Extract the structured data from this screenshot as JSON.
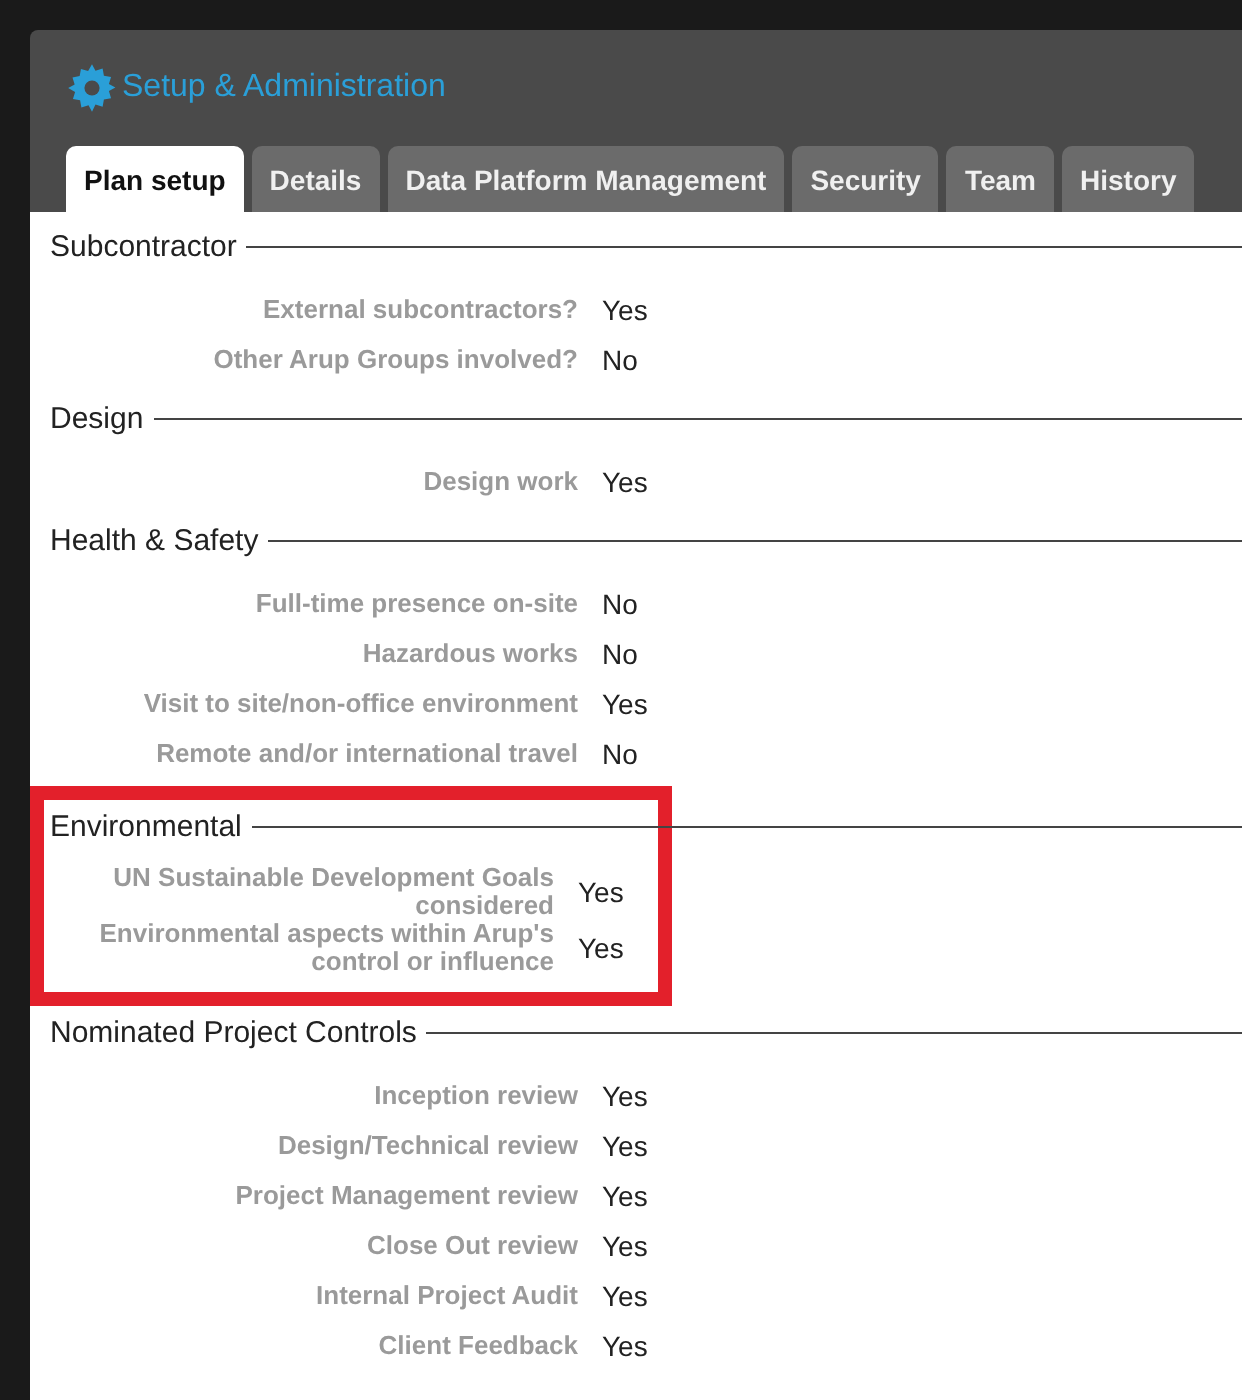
{
  "header": {
    "title": "Setup & Administration"
  },
  "tabs": [
    {
      "label": "Plan setup",
      "selected": true
    },
    {
      "label": "Details",
      "selected": false
    },
    {
      "label": "Data Platform Management",
      "selected": false
    },
    {
      "label": "Security",
      "selected": false
    },
    {
      "label": "Team",
      "selected": false
    },
    {
      "label": "History",
      "selected": false
    }
  ],
  "sections": [
    {
      "title": "Subcontractor",
      "highlighted": false,
      "rows": [
        {
          "label": "External subcontractors?",
          "value": "Yes"
        },
        {
          "label": "Other Arup Groups involved?",
          "value": "No"
        }
      ]
    },
    {
      "title": "Design",
      "highlighted": false,
      "rows": [
        {
          "label": "Design work",
          "value": "Yes"
        }
      ]
    },
    {
      "title": "Health & Safety",
      "highlighted": false,
      "rows": [
        {
          "label": "Full-time presence on-site",
          "value": "No"
        },
        {
          "label": "Hazardous works",
          "value": "No"
        },
        {
          "label": "Visit to site/non-office environment",
          "value": "Yes"
        },
        {
          "label": "Remote and/or international travel",
          "value": "No"
        }
      ]
    },
    {
      "title": "Environmental",
      "highlighted": true,
      "rows": [
        {
          "label": "UN Sustainable Development Goals considered",
          "value": "Yes"
        },
        {
          "label": "Environmental aspects within Arup's control or influence",
          "value": "Yes"
        }
      ]
    },
    {
      "title": "Nominated Project Controls",
      "highlighted": false,
      "rows": [
        {
          "label": "Inception review",
          "value": "Yes"
        },
        {
          "label": "Design/Technical review",
          "value": "Yes"
        },
        {
          "label": "Project Management review",
          "value": "Yes"
        },
        {
          "label": "Close Out review",
          "value": "Yes"
        },
        {
          "label": "Internal Project Audit",
          "value": "Yes"
        },
        {
          "label": "Client Feedback",
          "value": "Yes"
        }
      ]
    }
  ]
}
